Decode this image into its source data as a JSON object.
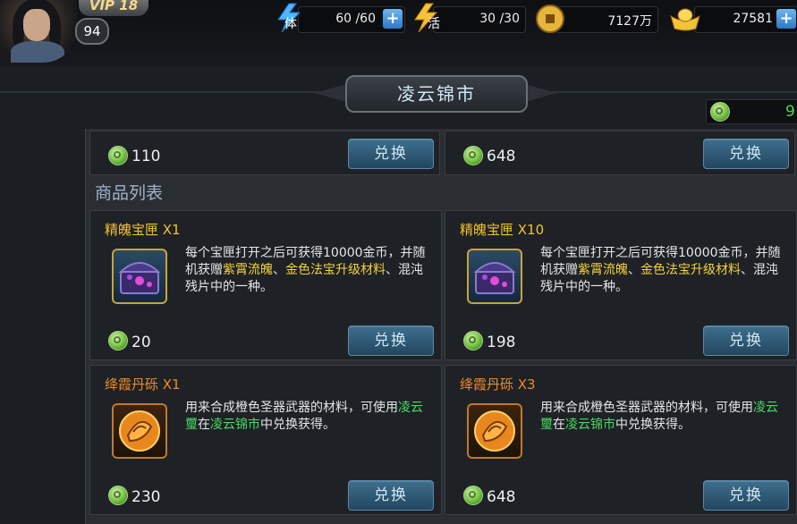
{
  "player": {
    "vip": "VIP 18",
    "level": "94"
  },
  "resources": [
    {
      "icon": "stamina-icon",
      "label": "体",
      "value": "60 /60"
    },
    {
      "icon": "vitality-icon",
      "label": "活",
      "value": "30 /30"
    },
    {
      "icon": "coin-icon",
      "value": "7127万"
    },
    {
      "icon": "gold-ingot-icon",
      "value": "27581"
    }
  ],
  "shop": {
    "title": "凌云锦市",
    "currency_value": "9",
    "section_title": "商品列表",
    "exchange_label": "兑换",
    "top_prices": [
      "110",
      "648"
    ],
    "items": [
      {
        "name": "精魄宝匣 X1",
        "desc_parts": [
          "每个宝匣打开之后可获得10000金币，并随机获赠",
          "紫霄流魄",
          "、",
          "金色法宝升级材料",
          "、混沌残片中的一种。"
        ],
        "price": "20"
      },
      {
        "name": "精魄宝匣 X10",
        "desc_parts": [
          "每个宝匣打开之后可获得10000金币，并随机获赠",
          "紫霄流魄",
          "、",
          "金色法宝升级材料",
          "、混沌残片中的一种。"
        ],
        "price": "198"
      },
      {
        "name": "绛霞丹砾 X1",
        "desc_parts": [
          "用来合成橙色圣器武器的材料，可使用",
          "凌云璽",
          "在",
          "凌云锦市",
          "中兑换获得。"
        ],
        "price": "230"
      },
      {
        "name": "绛霞丹砾 X3",
        "desc_parts": [
          "用来合成橙色圣器武器的材料，可使用",
          "凌云璽",
          "在",
          "凌云锦市",
          "中兑换获得。"
        ],
        "price": "648"
      }
    ]
  },
  "colors": {
    "accent_gold": "#f1c232",
    "accent_orange": "#f08a24",
    "highlight_green": "#4cd964",
    "button_blue": "#2f5a78"
  }
}
